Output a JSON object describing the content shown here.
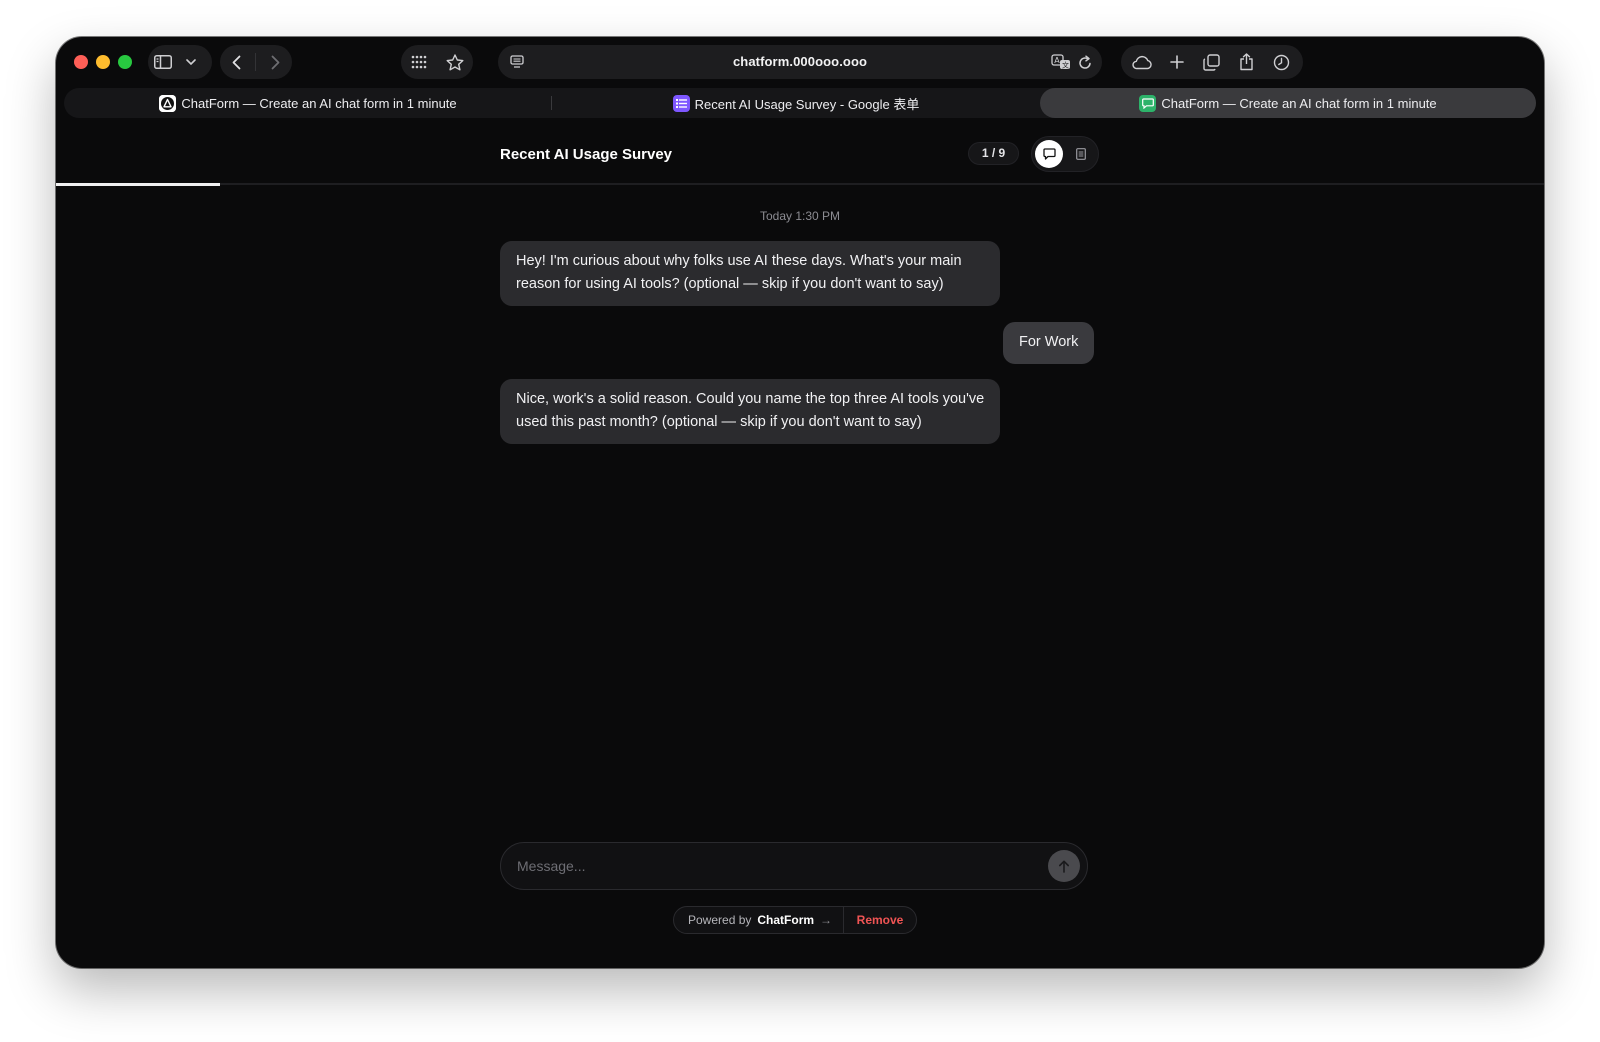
{
  "browser": {
    "url": "chatform.000ooo.ooo",
    "tabs": [
      {
        "label": "ChatForm — Create an AI chat form in 1 minute",
        "active": false
      },
      {
        "label": "Recent AI Usage Survey - Google 表单",
        "active": false
      },
      {
        "label": "ChatForm — Create an AI chat form in 1 minute",
        "active": true
      }
    ]
  },
  "form": {
    "title": "Recent AI Usage Survey",
    "progress_label": "1 / 9",
    "progress_fraction": 0.11
  },
  "chat": {
    "timestamp": "Today 1:30 PM",
    "messages": [
      {
        "role": "assistant",
        "text": "Hey! I'm curious about why folks use AI these days. What's your main reason for using AI tools? (optional — skip if you don't want to say)"
      },
      {
        "role": "user",
        "text": "For Work"
      },
      {
        "role": "assistant",
        "text": "Nice, work's a solid reason. Could you name the top three AI tools you've used this past month? (optional — skip if you don't want to say)"
      }
    ]
  },
  "composer": {
    "placeholder": "Message...",
    "value": ""
  },
  "footer": {
    "powered_by": "Powered by",
    "brand": "ChatForm",
    "arrow": "→",
    "remove_label": "Remove"
  },
  "colors": {
    "background": "#0a0a0b",
    "bubble": "#2b2b2e",
    "remove": "#f05454",
    "traffic_red": "#fe5f57",
    "traffic_yellow": "#febc2e",
    "traffic_green": "#28c840"
  }
}
